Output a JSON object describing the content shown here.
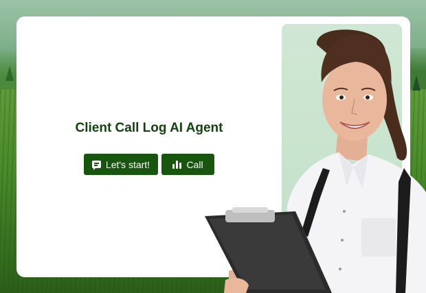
{
  "page": {
    "title": "Client Call Log AI Agent"
  },
  "actions": {
    "start_label": "Let's start!",
    "call_label": "Call"
  },
  "icons": {
    "start": "chat-icon",
    "call": "bar-chart-icon"
  },
  "colors": {
    "accent": "#18550f",
    "title": "#14410f",
    "panel": "#c9e4ce",
    "card": "#ffffff"
  }
}
